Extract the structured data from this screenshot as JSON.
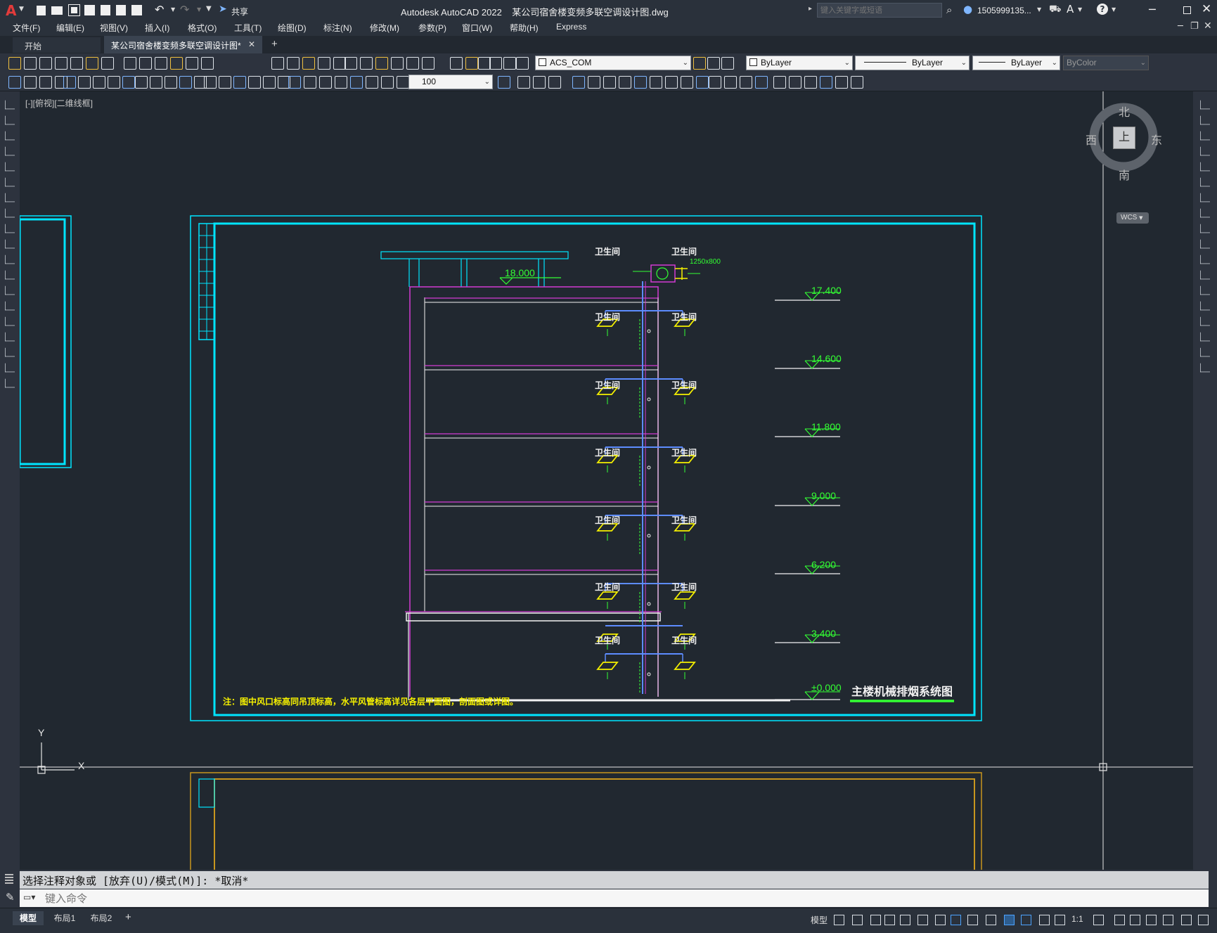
{
  "app": {
    "title": "Autodesk AutoCAD 2022    某公司宿舍楼变频多联空调设计图.dwg",
    "logo_letter": "A",
    "share_label": "共享",
    "search_placeholder": "键入关键字或短语",
    "user_label": "1505999135...",
    "help_label": "?"
  },
  "menu": [
    "文件(F)",
    "编辑(E)",
    "视图(V)",
    "插入(I)",
    "格式(O)",
    "工具(T)",
    "绘图(D)",
    "标注(N)",
    "修改(M)",
    "参数(P)",
    "窗口(W)",
    "帮助(H)",
    "Express"
  ],
  "tabs": {
    "start": "开始",
    "active": "某公司宿舍楼变频多联空调设计图*",
    "add": "+"
  },
  "toolbar": {
    "layer_combo": "ACS_COM",
    "color_combo": "ByLayer",
    "linetype_combo": "ByLayer",
    "lineweight_combo": "ByLayer",
    "plotstyle_combo": "ByColor",
    "scale_combo": "100"
  },
  "viewport": {
    "label": "[-][俯视][二维线框]",
    "viewcube": {
      "north": "北",
      "south": "南",
      "east": "东",
      "west": "西",
      "face": "上",
      "wcs": "WCS"
    },
    "ucs": {
      "y": "Y",
      "x": "X"
    }
  },
  "drawing": {
    "title": "主楼机械排烟系统图",
    "note": "注：图中风口标高同吊顶标高，水平风管标高详见各层平面图，剖面图或详图。",
    "duct_size": "1250x800",
    "roof_level": "18.000",
    "levels": [
      "17.400",
      "14.600",
      "11.800",
      "9.000",
      "6.200",
      "3.400",
      "±0.000"
    ],
    "room_label": "卫生间"
  },
  "command": {
    "history": "选择注释对象或 [放弃(U)/模式(M)]: *取消*",
    "placeholder": "键入命令"
  },
  "status": {
    "layout_tabs": [
      "模型",
      "布局1",
      "布局2"
    ],
    "add_tab": "+",
    "model_label": "模型",
    "scale": "1:1"
  },
  "colors": {
    "cyan": "#00e5ff",
    "magenta": "#d23bd2",
    "green": "#33ff33",
    "yellow": "#f5f000",
    "blue": "#5d8cff",
    "white": "#f2f2f2"
  }
}
